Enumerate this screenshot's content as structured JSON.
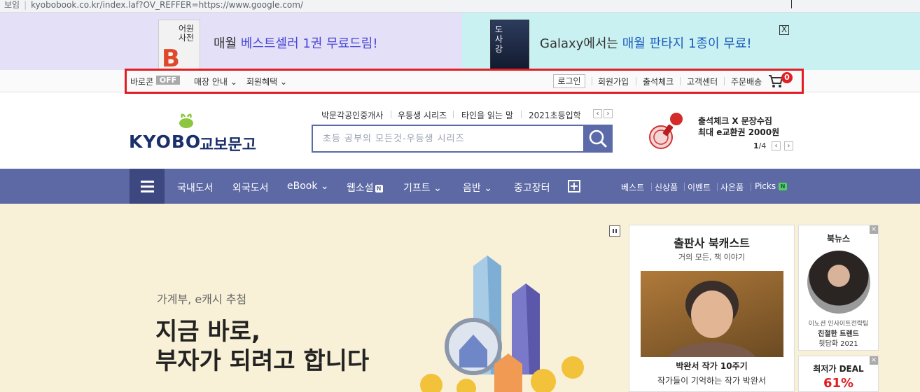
{
  "browser": {
    "left_text": "보임",
    "url": "kyobobook.co.kr/index.laf?OV_REFFER=https://www.google.com/"
  },
  "banner": {
    "left": {
      "prefix": "매월 ",
      "highlight": "베스트셀러 1권 무료드림!",
      "book_letter": "B",
      "book_title": "어원 사전"
    },
    "right": {
      "prefix": "Galaxy에서는 ",
      "highlight": "매월 판타지 1종이 무료!",
      "book_title": "도사강"
    },
    "close_label": "X"
  },
  "util": {
    "baroreon": "바로콘",
    "baroreon_state": "OFF",
    "store_info": "매장 안내",
    "member_benefit": "회원혜택",
    "login": "로그인",
    "join": "회원가입",
    "attendance": "출석체크",
    "customer_center": "고객센터",
    "order_delivery": "주문배송",
    "cart_count": "0"
  },
  "logo": {
    "english": "KYOBO",
    "korean": "교보문고"
  },
  "keywords": [
    "박문각공인중개사",
    "우등생 시리즈",
    "타인을 읽는 말",
    "2021초등입학"
  ],
  "search": {
    "placeholder": "초등 공부의 모든것-우등생 시리즈"
  },
  "promo": {
    "line1": "출석체크 X 문장수집",
    "line2": "최대 e교환권 2000원",
    "page_current": "1",
    "page_total": "/4"
  },
  "nav": {
    "items": [
      "국내도서",
      "외국도서",
      "eBook",
      "웹소설",
      "기프트",
      "음반",
      "중고장터"
    ],
    "new_badge": "N",
    "right": [
      "베스트",
      "신상품",
      "이벤트",
      "사은품",
      "Picks"
    ],
    "picks_badge": "N"
  },
  "hero": {
    "subtitle": "가계부, e캐시 추첨",
    "title_line1": "지금 바로,",
    "title_line2": "부자가 되려고 합니다"
  },
  "podcast": {
    "title": "출판사 북캐스트",
    "subtitle": "거의 모든, 책 이야기",
    "name": "박완서 작가 10주기",
    "desc": "작가들이 기억하는 작가 박완서"
  },
  "news": {
    "title": "북뉴스",
    "line1": "이노션 인사이트전략팀",
    "line2": "친절한 트렌드",
    "line3": "뒷담화 2021"
  },
  "deal": {
    "title": "최저가 DEAL",
    "percent": "61%"
  },
  "colors": {
    "nav": "#5d69a5",
    "hero_bg": "#f8f1d7",
    "accent_red": "#e01e24",
    "brand_navy": "#1a2f6b"
  }
}
